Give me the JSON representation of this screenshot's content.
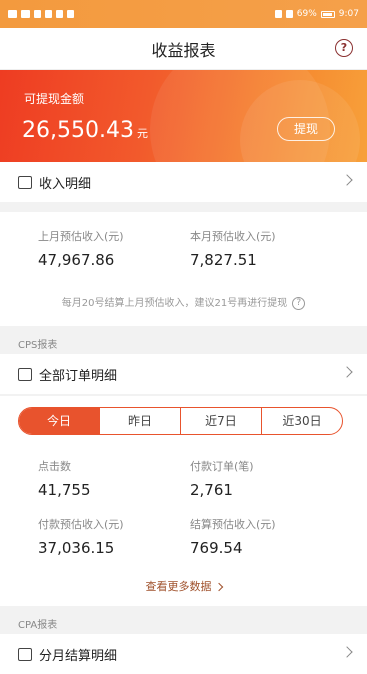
{
  "status": {
    "time": "9:07",
    "battery": "69%"
  },
  "nav": {
    "title": "收益报表",
    "help": "?"
  },
  "banner": {
    "label": "可提现金额",
    "amount": "26,550.43",
    "unit": "元",
    "withdraw": "提现"
  },
  "income_detail": {
    "label": "收入明细"
  },
  "summary": {
    "last_month_label": "上月预估收入(元)",
    "last_month_value": "47,967.86",
    "this_month_label": "本月预估收入(元)",
    "this_month_value": "7,827.51",
    "note": "每月20号结算上月预估收入，建议21号再进行提现"
  },
  "cps": {
    "section": "CPS报表",
    "orders_label": "全部订单明细",
    "tabs": [
      "今日",
      "昨日",
      "近7日",
      "近30日"
    ],
    "active_tab": 0,
    "metrics": {
      "clicks_label": "点击数",
      "clicks_value": "41,755",
      "paid_orders_label": "付款订单(笔)",
      "paid_orders_value": "2,761",
      "paid_income_label": "付款预估收入(元)",
      "paid_income_value": "37,036.15",
      "settled_income_label": "结算预估收入(元)",
      "settled_income_value": "769.54"
    },
    "more": "查看更多数据"
  },
  "cpa": {
    "section": "CPA报表",
    "monthly_label": "分月结算明细"
  }
}
